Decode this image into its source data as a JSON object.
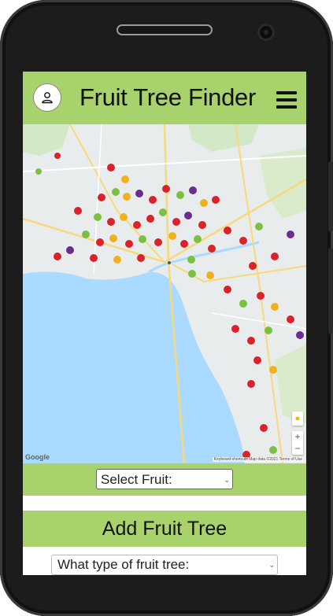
{
  "header": {
    "title": "Fruit Tree Finder",
    "avatar_icon": "user-icon",
    "menu_icon": "hamburger-menu-icon"
  },
  "map": {
    "logo": "Google",
    "credits": "Keyboard shortcuts   Map data ©2021   Terms of Use",
    "zoom_in": "+",
    "zoom_out": "−",
    "fruit_markers_note": ""
  },
  "filter": {
    "selected": "Select Fruit:"
  },
  "add_section": {
    "title": "Add Fruit Tree",
    "type_placeholder": "What type of fruit tree:"
  },
  "colors": {
    "accent_green": "#a8d36c",
    "bay_water": "#aadaff",
    "land": "#e9ecec"
  }
}
